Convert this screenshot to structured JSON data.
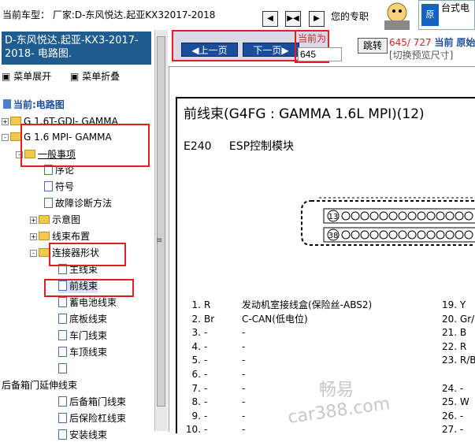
{
  "topbar": {
    "vehicle_line": "当前车型： 厂家:D-东风悦达.起亚KX32017-2018",
    "pro_text": "您的专职",
    "ad_text": "台式电",
    "ad_logo": "原"
  },
  "left": {
    "title": "D-东风悦达.起亚-KX3-2017-2018- 电路图.",
    "menu_expand": "菜单展开",
    "menu_collapse": "菜单折叠",
    "current": "当前:电路图",
    "tree": {
      "n1": "G 1.6T-GDI- GAMMA",
      "n2": "G 1.6 MPI- GAMMA",
      "n3": "一般事项",
      "n4": "序论",
      "n5": "符号",
      "n6": "故障诊断方法",
      "n7": "示意图",
      "n8": "线束布置",
      "n9": "连接器形状",
      "n10": "主线束",
      "n11": "前线束",
      "n12": "蓄电池线束",
      "n13": "底板线束",
      "n14": "车门线束",
      "n15": "车顶线束",
      "n16": "后备箱门延伸线束",
      "n17": "后备箱门线束",
      "n18": "后保险杠线束",
      "n19": "安装线束"
    }
  },
  "toolbar": {
    "prev": "上一页",
    "next": "下一页",
    "current_label": "当前为",
    "current_value": "645",
    "jump": "跳转",
    "page_info": "645/ 727",
    "page_info_tail": "当前",
    "page_info_bold": "原始",
    "hint": "[切换预览尺寸]"
  },
  "doc": {
    "title": "前线束(G4FG : GAMMA 1.6L MPI)(12)",
    "module_code": "E240",
    "module_name": "ESP控制模块",
    "pin_13": "13",
    "pin_38": "38",
    "pins_left": [
      {
        "no": "1.",
        "code": "R",
        "desc": "发动机室接线盒(保险丝-ABS2)"
      },
      {
        "no": "2.",
        "code": "Br",
        "desc": "C-CAN(低电位)"
      },
      {
        "no": "3.",
        "code": "-",
        "desc": "-"
      },
      {
        "no": "4.",
        "code": "-",
        "desc": "-"
      },
      {
        "no": "5.",
        "code": "-",
        "desc": "-"
      },
      {
        "no": "6.",
        "code": "-",
        "desc": "-"
      },
      {
        "no": "7.",
        "code": "-",
        "desc": "-"
      },
      {
        "no": "8.",
        "code": "-",
        "desc": "-"
      },
      {
        "no": "9.",
        "code": "-",
        "desc": "-"
      },
      {
        "no": "10.",
        "code": "-",
        "desc": "-"
      }
    ],
    "pins_right": [
      {
        "no": "19.",
        "code": "Y"
      },
      {
        "no": "20.",
        "code": "Gr/"
      },
      {
        "no": "21.",
        "code": "B"
      },
      {
        "no": "22.",
        "code": "R"
      },
      {
        "no": "23.",
        "code": "R/B"
      },
      {
        "no": "",
        "code": ""
      },
      {
        "no": "24.",
        "code": "-"
      },
      {
        "no": "25.",
        "code": "W"
      },
      {
        "no": "26.",
        "code": "-"
      },
      {
        "no": "27.",
        "code": "-"
      }
    ],
    "watermark1": "畅易",
    "watermark2": "car388.com"
  }
}
